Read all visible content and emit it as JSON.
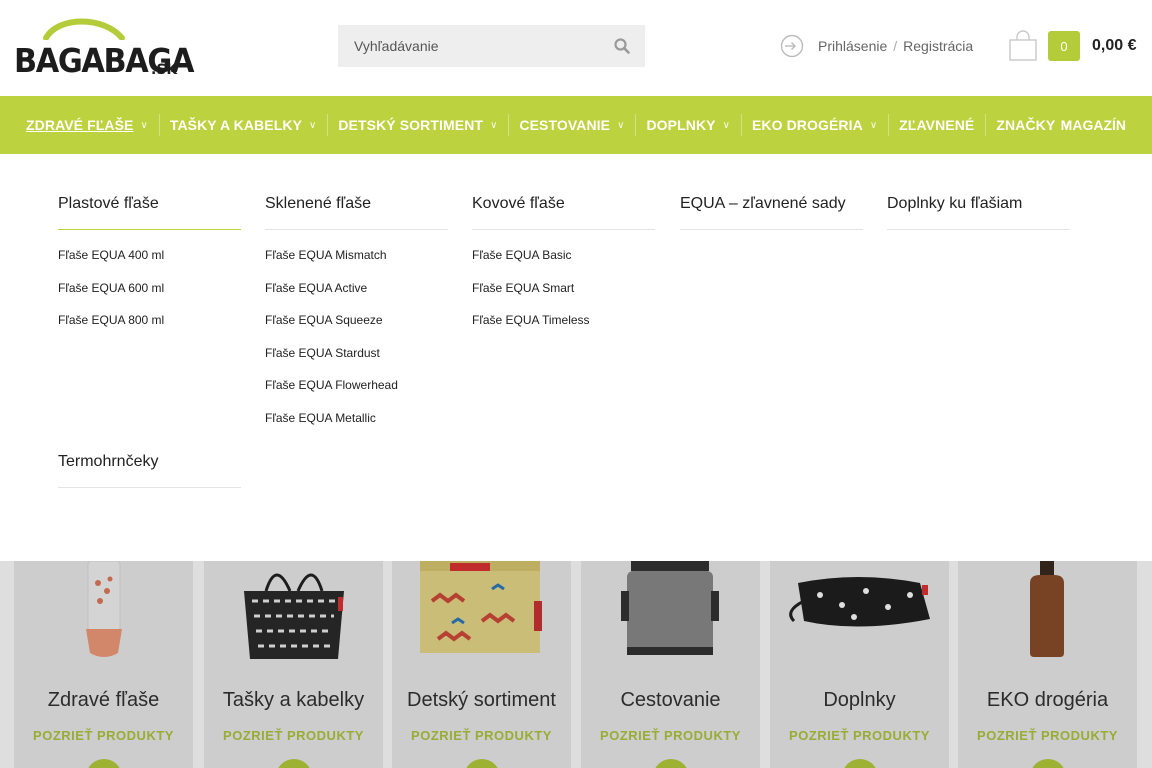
{
  "header": {
    "logo_text": "BAGABAGA",
    "logo_suffix": ".SK",
    "search_placeholder": "Vyhľadávanie",
    "login_label": "Prihlásenie",
    "login_separator": "/",
    "register_label": "Registrácia",
    "cart_count": "0",
    "cart_total": "0,00 €"
  },
  "colors": {
    "accent": "#bcd23e",
    "accent_text": "#b0c63c",
    "tile_bg": "#ececec"
  },
  "nav": {
    "items": [
      {
        "label": "Zdravé fľaše",
        "active": true,
        "dropdown": true
      },
      {
        "label": "Tašky a kabelky",
        "dropdown": true
      },
      {
        "label": "Detský sortiment",
        "dropdown": true
      },
      {
        "label": "Cestovanie",
        "dropdown": true
      },
      {
        "label": "Doplnky",
        "dropdown": true
      },
      {
        "label": "EKO drogéria",
        "dropdown": true
      },
      {
        "label": "Zľavnené",
        "dropdown": false
      },
      {
        "label": "Značky",
        "dropdown": true
      }
    ],
    "right_label": "MAGAZÍN"
  },
  "mega_menu": {
    "columns": [
      {
        "title": "Plastové fľaše",
        "items": [
          "Fľaše EQUA 400 ml",
          "Fľaše EQUA 600 ml",
          "Fľaše EQUA 800 ml"
        ]
      },
      {
        "title": "Sklenené fľaše",
        "items": [
          "Fľaše EQUA Mismatch",
          "Fľaše EQUA Active",
          "Fľaše EQUA Squeeze",
          "Fľaše EQUA Stardust",
          "Fľaše EQUA Flowerhead",
          "Fľaše EQUA Metallic"
        ]
      },
      {
        "title": "Kovové fľaše",
        "items": [
          "Fľaše EQUA Basic",
          "Fľaše EQUA Smart",
          "Fľaše EQUA Timeless"
        ]
      },
      {
        "title": "EQUA – zľavnené sady",
        "items": []
      },
      {
        "title": "Doplnky ku fľašiam",
        "items": []
      },
      {
        "title": "Termohrnčeky",
        "items": []
      }
    ]
  },
  "tiles": [
    {
      "title": "Zdravé fľaše",
      "link": "POZRIEŤ PRODUKTY"
    },
    {
      "title": "Tašky a kabelky",
      "link": "POZRIEŤ PRODUKTY"
    },
    {
      "title": "Detský sortiment",
      "link": "POZRIEŤ PRODUKTY"
    },
    {
      "title": "Cestovanie",
      "link": "POZRIEŤ PRODUKTY"
    },
    {
      "title": "Doplnky",
      "link": "POZRIEŤ PRODUKTY"
    },
    {
      "title": "EKO drogéria",
      "link": "POZRIEŤ PRODUKTY"
    }
  ]
}
